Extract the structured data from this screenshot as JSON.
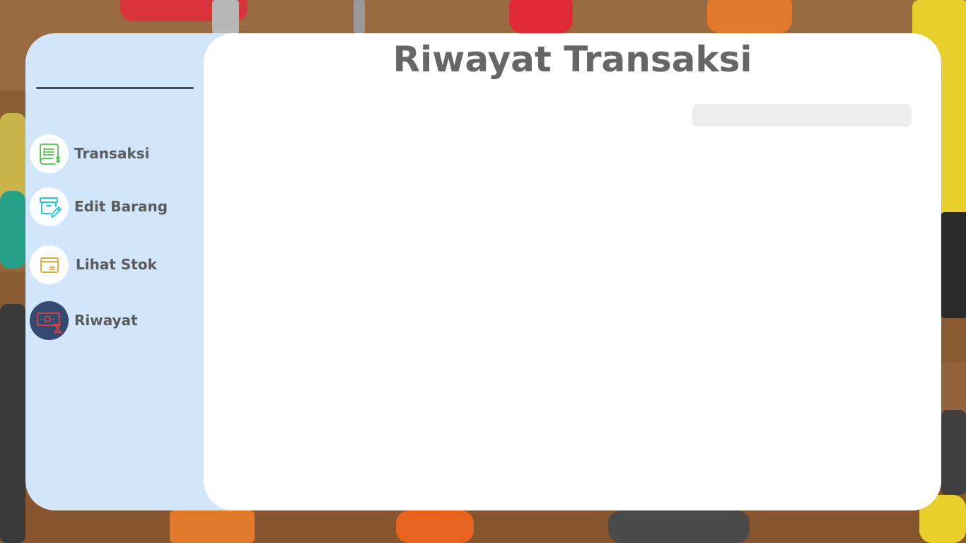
{
  "page": {
    "title": "Riwayat Transaksi"
  },
  "sidebar": {
    "items": [
      {
        "label": "Transaksi",
        "icon": "receipt-dollar-icon",
        "active": false
      },
      {
        "label": "Edit Barang",
        "icon": "box-edit-icon",
        "active": false
      },
      {
        "label": "Lihat Stok",
        "icon": "package-icon",
        "active": false
      },
      {
        "label": "Riwayat",
        "icon": "money-history-icon",
        "active": true
      }
    ]
  },
  "search": {
    "value": "",
    "placeholder": ""
  },
  "colors": {
    "sidebar_bg": "#d1e5fb",
    "panel_bg": "#ffffff",
    "active_icon_bg": "#344a73",
    "title_text": "#666666",
    "nav_text": "#5b5b5b",
    "transaksi_icon": "#4cc44c",
    "edit_icon": "#26c6da",
    "stok_icon": "#e0a83a",
    "riwayat_icon": "#e0463c"
  }
}
